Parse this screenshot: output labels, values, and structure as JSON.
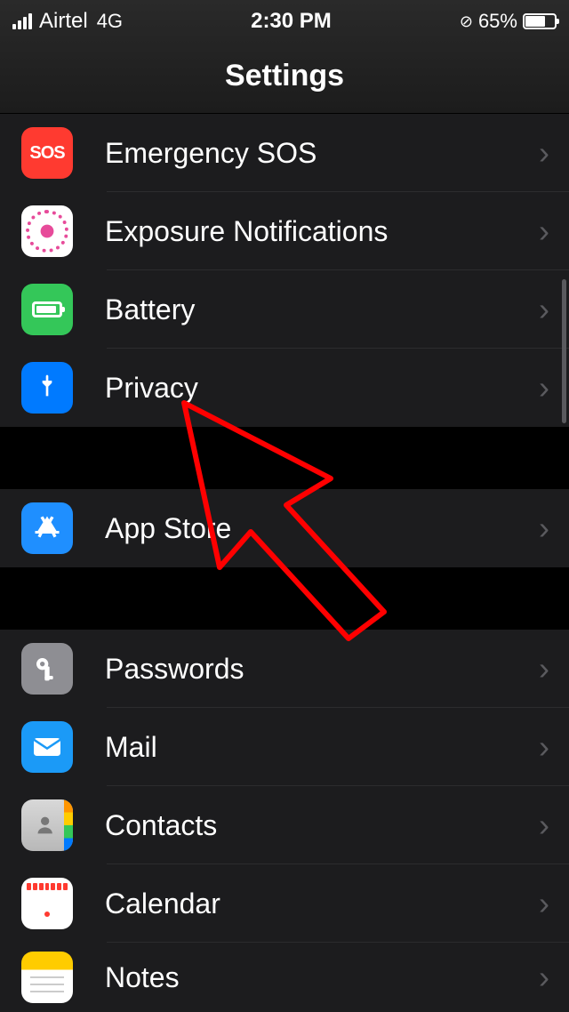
{
  "statusbar": {
    "carrier": "Airtel",
    "network": "4G",
    "time": "2:30 PM",
    "battery_pct": "65%"
  },
  "header": {
    "title": "Settings"
  },
  "sections": [
    {
      "rows": [
        {
          "id": "emergency-sos",
          "label": "Emergency SOS",
          "icon": "sos"
        },
        {
          "id": "exposure",
          "label": "Exposure Notifications",
          "icon": "exposure"
        },
        {
          "id": "battery",
          "label": "Battery",
          "icon": "battery"
        },
        {
          "id": "privacy",
          "label": "Privacy",
          "icon": "privacy"
        }
      ]
    },
    {
      "rows": [
        {
          "id": "appstore",
          "label": "App Store",
          "icon": "appstore"
        }
      ]
    },
    {
      "rows": [
        {
          "id": "passwords",
          "label": "Passwords",
          "icon": "passwords"
        },
        {
          "id": "mail",
          "label": "Mail",
          "icon": "mail"
        },
        {
          "id": "contacts",
          "label": "Contacts",
          "icon": "contacts"
        },
        {
          "id": "calendar",
          "label": "Calendar",
          "icon": "calendar"
        },
        {
          "id": "notes",
          "label": "Notes",
          "icon": "notes"
        }
      ]
    }
  ],
  "annotation": {
    "type": "red-arrow-cursor",
    "color": "#ff0000"
  }
}
